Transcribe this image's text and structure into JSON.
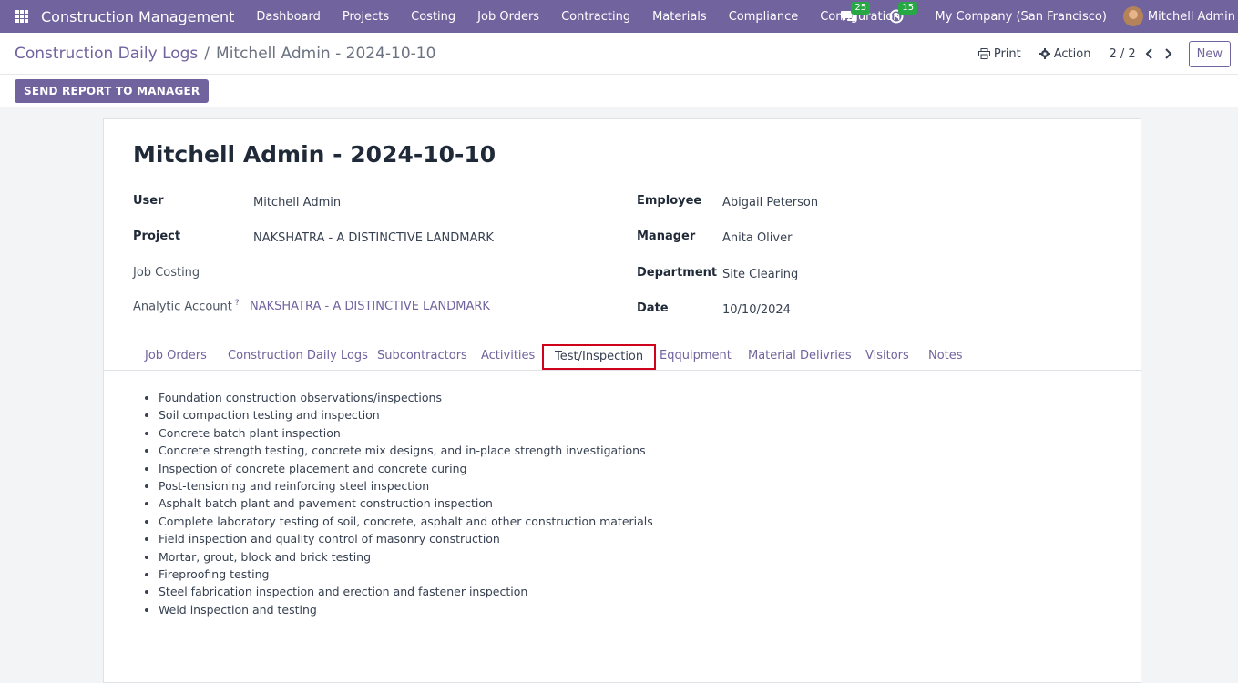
{
  "navbar": {
    "brand": "Construction Management",
    "menu": [
      "Dashboard",
      "Projects",
      "Costing",
      "Job Orders",
      "Contracting",
      "Materials",
      "Compliance",
      "Configuration"
    ],
    "messages_count": "25",
    "activities_count": "15",
    "company": "My Company (San Francisco)",
    "user": "Mitchell Admin"
  },
  "control": {
    "breadcrumb_parent": "Construction Daily Logs",
    "breadcrumb_sep": "/",
    "breadcrumb_current": "Mitchell Admin - 2024-10-10",
    "print_label": "Print",
    "action_label": "Action",
    "pager": "2 / 2",
    "new_label": "New"
  },
  "statusbar": {
    "send_report_label": "SEND REPORT TO MANAGER"
  },
  "record": {
    "title": "Mitchell Admin - 2024-10-10",
    "fields": {
      "user_label": "User",
      "user_value": "Mitchell Admin",
      "project_label": "Project",
      "project_value": "NAKSHATRA - A DISTINCTIVE LANDMARK",
      "job_costing_label": "Job Costing",
      "analytic_label": "Analytic Account",
      "analytic_help": "?",
      "analytic_value": "NAKSHATRA - A DISTINCTIVE LANDMARK",
      "employee_label": "Employee",
      "employee_value": "Abigail Peterson",
      "manager_label": "Manager",
      "manager_value": "Anita Oliver",
      "department_label": "Department",
      "department_value": "Site Clearing",
      "date_label": "Date",
      "date_value": "10/10/2024"
    }
  },
  "tabs": [
    "Job Orders",
    "Construction Daily Logs",
    "Subcontractors",
    "Activities",
    "Test/Inspection",
    "Eqquipment",
    "Material Delivries",
    "Visitors",
    "Notes"
  ],
  "active_tab": "Test/Inspection",
  "inspection_items": [
    "Foundation construction observations/inspections",
    "Soil compaction testing and inspection",
    "Concrete batch plant inspection",
    "Concrete strength testing, concrete mix designs, and in-place strength investigations",
    "Inspection of concrete placement and concrete curing",
    "Post-tensioning and reinforcing steel inspection",
    "Asphalt batch plant and pavement construction inspection",
    "Complete laboratory testing of soil, concrete, asphalt and other construction materials",
    "Field inspection and quality control of masonry construction",
    "Mortar, grout, block and brick testing",
    "Fireproofing testing",
    "Steel fabrication inspection and erection and fastener inspection",
    "Weld inspection and testing"
  ],
  "colors": {
    "brand": "#71639e",
    "badge": "#28a745",
    "active_tab_outline": "#d0021b"
  }
}
